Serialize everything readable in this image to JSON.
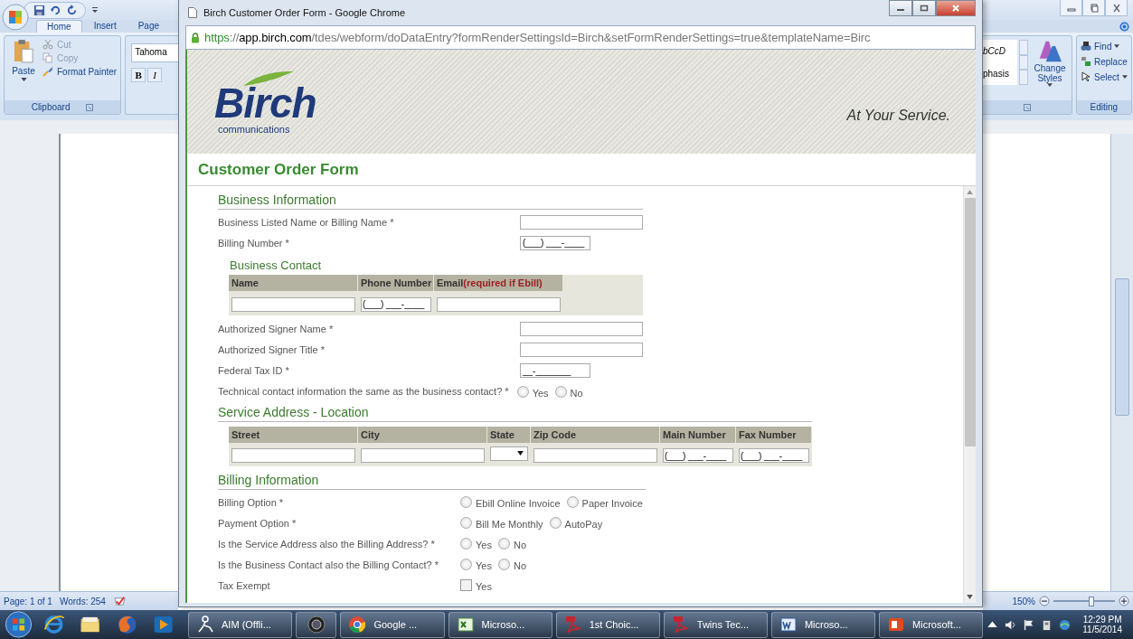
{
  "word": {
    "tabs": [
      {
        "label": "Home",
        "selected": true
      },
      {
        "label": "Insert",
        "selected": false
      },
      {
        "label": "Page",
        "selected": false
      }
    ],
    "clipboard": {
      "paste": "Paste",
      "group": "Clipboard",
      "commands": [
        {
          "kind": "cut",
          "label": "Cut",
          "disabled": true
        },
        {
          "kind": "copy",
          "label": "Copy",
          "disabled": true
        },
        {
          "kind": "painter",
          "label": "Format Painter",
          "disabled": false
        }
      ]
    },
    "font": {
      "name": "Tahoma",
      "bold": "B",
      "italic": "I"
    },
    "styles": {
      "preview": "bCcD",
      "name": "phasis",
      "change": "Change Styles"
    },
    "editing": {
      "group": "Editing",
      "commands": [
        {
          "kind": "find",
          "label": "Find",
          "dropdown": true
        },
        {
          "kind": "replace",
          "label": "Replace",
          "dropdown": false
        },
        {
          "kind": "select",
          "label": "Select",
          "dropdown": true
        }
      ]
    },
    "status": {
      "page": "Page: 1 of 1",
      "words": "Words: 254",
      "zoom": "150%",
      "zoom_slider": {
        "level": 0.62
      }
    }
  },
  "chrome": {
    "title": "Birch Customer Order Form - Google Chrome",
    "url": {
      "scheme": "https",
      "separator": "://",
      "host": "app.birch.com",
      "path": "/tdes/webform/doDataEntry?formRenderSettingsId=Birch&setFormRenderSettings=true&templateName=Birc"
    }
  },
  "page": {
    "brand": "Birch",
    "brand_sub": "communications",
    "tagline": "At Your Service.",
    "title": "Customer Order Form",
    "sections": [
      {
        "title": "Business Information",
        "rows": [
          {
            "kind": "text",
            "label": "Business Listed Name or Billing Name *"
          },
          {
            "kind": "masked",
            "label": "Billing Number *",
            "value": "(___) ___-____"
          },
          {
            "kind": "table",
            "title": "Business Contact",
            "columns": [
              {
                "label": "Name",
                "kind": "text"
              },
              {
                "label": "Phone Number",
                "kind": "masked",
                "value": "(___) ___-____"
              },
              {
                "label": "Email",
                "note": "(required if Ebill)",
                "kind": "text"
              }
            ]
          },
          {
            "kind": "text",
            "label": "Authorized Signer Name *"
          },
          {
            "kind": "text",
            "label": "Authorized Signer Title *"
          },
          {
            "kind": "masked",
            "label": "Federal Tax ID *",
            "value": "__-_______"
          },
          {
            "kind": "radio",
            "label": "Technical contact information the same as the business contact? *",
            "options": [
              {
                "label": "Yes",
                "selected": false
              },
              {
                "label": "No",
                "selected": false
              }
            ]
          }
        ]
      },
      {
        "title": "Service Address - Location",
        "rows": [
          {
            "kind": "table",
            "columns": [
              {
                "label": "Street",
                "kind": "text"
              },
              {
                "label": "City",
                "kind": "text"
              },
              {
                "label": "State",
                "kind": "select"
              },
              {
                "label": "Zip Code",
                "kind": "text"
              },
              {
                "label": "Main Number",
                "kind": "masked",
                "value": "(___) ___-____"
              },
              {
                "label": "Fax Number",
                "kind": "masked",
                "value": "(___) ___-____"
              }
            ]
          }
        ]
      },
      {
        "title": "Billing Information",
        "rows": [
          {
            "kind": "radio",
            "label": "Billing Option *",
            "options": [
              {
                "label": "Ebill Online Invoice",
                "selected": false
              },
              {
                "label": "Paper Invoice",
                "selected": false
              }
            ]
          },
          {
            "kind": "radio",
            "label": "Payment Option *",
            "options": [
              {
                "label": "Bill Me Monthly",
                "selected": false
              },
              {
                "label": "AutoPay",
                "selected": false
              }
            ]
          },
          {
            "kind": "radio",
            "label": "Is the Service Address also the Billing Address? *",
            "options": [
              {
                "label": "Yes",
                "selected": false
              },
              {
                "label": "No",
                "selected": false
              }
            ]
          },
          {
            "kind": "radio",
            "label": "Is the Business Contact also the Billing Contact? *",
            "options": [
              {
                "label": "Yes",
                "selected": false
              },
              {
                "label": "No",
                "selected": false
              }
            ]
          },
          {
            "kind": "checkbox",
            "label": "Tax Exempt",
            "options": [
              {
                "label": "Yes",
                "checked": false
              }
            ]
          }
        ]
      }
    ]
  },
  "taskbar": {
    "windows": [
      {
        "kind": "aim",
        "label": "AIM (Offli..."
      },
      {
        "kind": "camera"
      },
      {
        "kind": "chrome",
        "label": "Google ..."
      },
      {
        "kind": "excel",
        "label": "Microso..."
      },
      {
        "kind": "pdf",
        "label": "1st Choic..."
      },
      {
        "kind": "pdf",
        "label": "Twins Tec..."
      },
      {
        "kind": "word",
        "label": "Microso..."
      },
      {
        "kind": "office",
        "label": "Microsoft..."
      }
    ],
    "time": "12:29 PM",
    "date": "11/5/2014"
  }
}
